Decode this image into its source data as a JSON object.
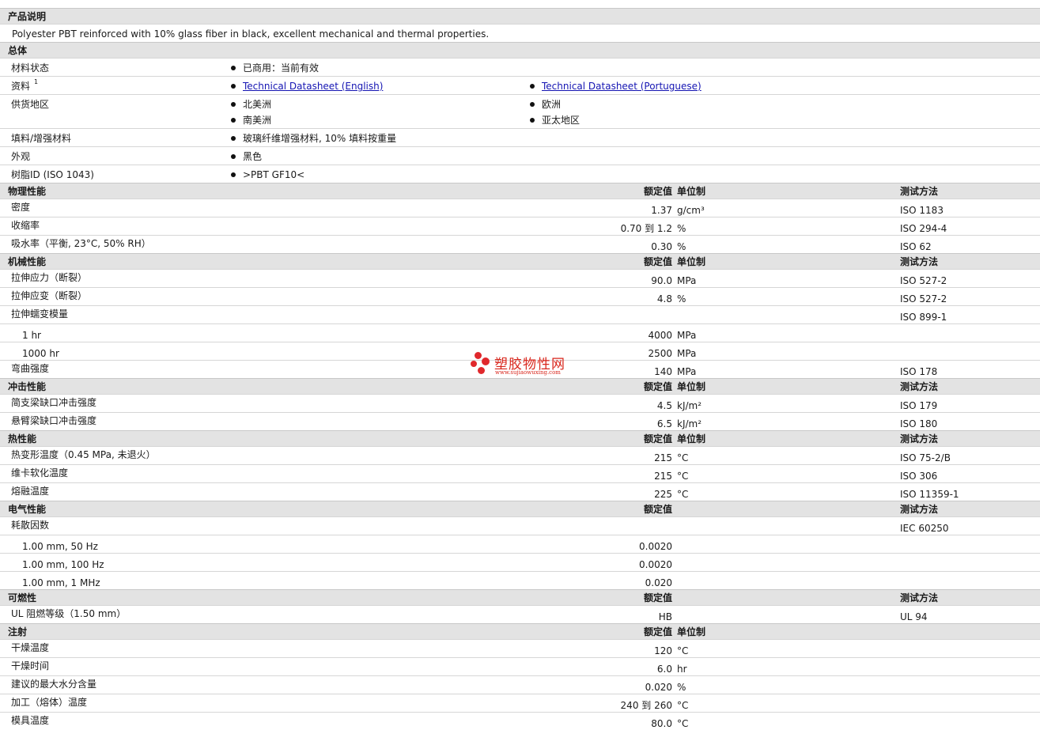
{
  "description": {
    "header": "产品说明",
    "text": "Polyester PBT reinforced with 10% glass fiber in black, excellent mechanical and thermal properties."
  },
  "general": {
    "header": "总体",
    "rows": [
      {
        "label": "材料状态",
        "left": [
          "已商用：当前有效"
        ],
        "right": []
      },
      {
        "label": "资料",
        "sup": "1",
        "left_links": [
          "Technical Datasheet (English)"
        ],
        "right_links": [
          "Technical Datasheet (Portuguese)"
        ]
      },
      {
        "label": "供货地区",
        "left": [
          "北美洲",
          "南美洲"
        ],
        "right": [
          "欧洲",
          "亚太地区"
        ]
      },
      {
        "label": "填料/增强材料",
        "left": [
          "玻璃纤维增强材料, 10% 填料按重量"
        ],
        "right": []
      },
      {
        "label": "外观",
        "left": [
          "黑色"
        ],
        "right": []
      },
      {
        "label": "树脂ID (ISO 1043)",
        "left": [
          ">PBT GF10<"
        ],
        "right": []
      }
    ]
  },
  "columns": {
    "nominal": "额定值",
    "unit": "单位制",
    "method": "测试方法"
  },
  "sections": [
    {
      "title": "物理性能",
      "show_unit": true,
      "show_method": true,
      "rows": [
        {
          "label": "密度",
          "value": "1.37",
          "unit": "g/cm³",
          "method": "ISO 1183"
        },
        {
          "label": "收缩率",
          "value": "0.70 到  1.2",
          "unit": "%",
          "method": "ISO 294-4"
        },
        {
          "label": "吸水率（平衡, 23°C, 50% RH）",
          "value": "0.30",
          "unit": "%",
          "method": "ISO 62"
        }
      ]
    },
    {
      "title": "机械性能",
      "show_unit": true,
      "show_method": true,
      "rows": [
        {
          "label": "拉伸应力（断裂）",
          "value": "90.0",
          "unit": "MPa",
          "method": "ISO 527-2"
        },
        {
          "label": "拉伸应变（断裂）",
          "value": "4.8",
          "unit": "%",
          "method": "ISO 527-2"
        },
        {
          "label": "拉伸蠕变模量",
          "value": "",
          "unit": "",
          "method": "ISO 899-1"
        },
        {
          "label": "1 hr",
          "sub": true,
          "value": "4000",
          "unit": "MPa",
          "method": ""
        },
        {
          "label": "1000 hr",
          "sub": true,
          "value": "2500",
          "unit": "MPa",
          "method": ""
        },
        {
          "label": "弯曲强度",
          "value": "140",
          "unit": "MPa",
          "method": "ISO 178"
        }
      ]
    },
    {
      "title": "冲击性能",
      "show_unit": true,
      "show_method": true,
      "rows": [
        {
          "label": "简支梁缺口冲击强度",
          "value": "4.5",
          "unit": "kJ/m²",
          "method": "ISO 179"
        },
        {
          "label": "悬臂梁缺口冲击强度",
          "value": "6.5",
          "unit": "kJ/m²",
          "method": "ISO 180"
        }
      ]
    },
    {
      "title": "热性能",
      "show_unit": true,
      "show_method": true,
      "rows": [
        {
          "label": "热变形温度（0.45 MPa, 未退火）",
          "value": "215",
          "unit": "°C",
          "method": "ISO 75-2/B"
        },
        {
          "label": "维卡软化温度",
          "value": "215",
          "unit": "°C",
          "method": "ISO 306"
        },
        {
          "label": "熔融温度",
          "value": "225",
          "unit": "°C",
          "method": "ISO 11359-1"
        }
      ]
    },
    {
      "title": "电气性能",
      "show_unit": false,
      "show_method": true,
      "rows": [
        {
          "label": "耗散因数",
          "value": "",
          "unit": "",
          "method": "IEC 60250"
        },
        {
          "label": "1.00 mm, 50 Hz",
          "sub": true,
          "value": "0.0020",
          "unit": "",
          "method": ""
        },
        {
          "label": "1.00 mm, 100 Hz",
          "sub": true,
          "value": "0.0020",
          "unit": "",
          "method": ""
        },
        {
          "label": "1.00 mm, 1 MHz",
          "sub": true,
          "value": "0.020",
          "unit": "",
          "method": ""
        }
      ]
    },
    {
      "title": "可燃性",
      "show_unit": false,
      "show_method": true,
      "rows": [
        {
          "label": "UL 阻燃等级（1.50 mm）",
          "value": "HB",
          "unit": "",
          "method": "UL 94"
        }
      ]
    },
    {
      "title": "注射",
      "show_unit": true,
      "show_method": false,
      "rows": [
        {
          "label": "干燥温度",
          "value": "120",
          "unit": "°C",
          "method": ""
        },
        {
          "label": "干燥时间",
          "value": "6.0",
          "unit": "hr",
          "method": ""
        },
        {
          "label": "建议的最大水分含量",
          "value": "0.020",
          "unit": "%",
          "method": ""
        },
        {
          "label": "加工（熔体）温度",
          "value": "240 到  260",
          "unit": "°C",
          "method": ""
        },
        {
          "label": "模具温度",
          "value": "80.0",
          "unit": "°C",
          "method": ""
        }
      ]
    }
  ],
  "watermark": {
    "name": "塑胶物性网",
    "url": "www.sujiaowuxing.com",
    "color": "#d9261c"
  }
}
